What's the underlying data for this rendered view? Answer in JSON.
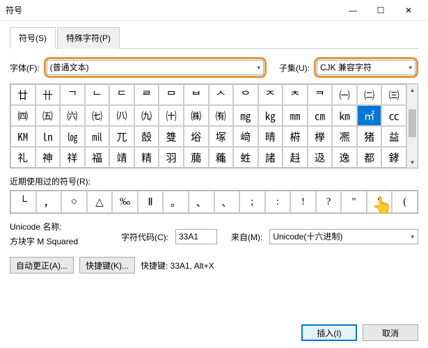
{
  "window": {
    "title": "符号",
    "minimizeGlyph": "—",
    "maximizeGlyph": "☐",
    "closeGlyph": "✕"
  },
  "tabs": {
    "symbols": "符号(S)",
    "special": "特殊字符(P)"
  },
  "fontRow": {
    "label": "字体(F):",
    "fontValue": "(普通文本)",
    "subsetLabel": "子集(U):",
    "subsetValue": "CJK 兼容字符"
  },
  "grid": {
    "rows": [
      [
        "廿",
        "卄",
        "ᄀ",
        "ᄂ",
        "ᄃ",
        "ᄅ",
        "ᄆ",
        "ᄇ",
        "ᄉ",
        "ᄋ",
        "ᄌ",
        "ᄎ",
        "ᄏ",
        "㈠",
        "㈡",
        "㈢"
      ],
      [
        "㈣",
        "㈤",
        "㈥",
        "㈦",
        "㈧",
        "㈨",
        "㈩",
        "㈱",
        "㈲",
        "㎎",
        "㎏",
        "㎜",
        "㎝",
        "㎞",
        "㎡",
        "㏄"
      ],
      [
        "㏎",
        "㏑",
        "㏒",
        "㏕",
        "兀",
        "嗀",
        "﨎",
        "﨏",
        "塚",
        "﨑",
        "晴",
        "﨓",
        "﨔",
        "凞",
        "猪",
        "益"
      ],
      [
        "礼",
        "神",
        "祥",
        "福",
        "靖",
        "精",
        "羽",
        "﨟",
        "蘒",
        "﨡",
        "諸",
        "﨣",
        "﨤",
        "逸",
        "都",
        "﨧"
      ]
    ],
    "selectedRow": 1,
    "selectedCol": 14
  },
  "recent": {
    "label": "近期使用过的符号(R):",
    "items": [
      "└",
      "，",
      "○",
      "△",
      "‰",
      "Ⅱ",
      "。",
      "、",
      "、",
      ";",
      ":",
      "!",
      "?",
      "\"",
      "\"",
      "("
    ]
  },
  "unicode": {
    "nameLabel": "Unicode 名称:",
    "nameValue": "方块字 M Squared",
    "codeLabel": "字符代码(C):",
    "codeValue": "33A1",
    "fromLabel": "来自(M):",
    "fromValue": "Unicode(十六进制)"
  },
  "buttons": {
    "autocorrect": "自动更正(A)...",
    "shortcut": "快捷键(K)...",
    "shortcutInfo": "快捷键: 33A1, Alt+X",
    "insert": "插入(I)",
    "cancel": "取消"
  }
}
